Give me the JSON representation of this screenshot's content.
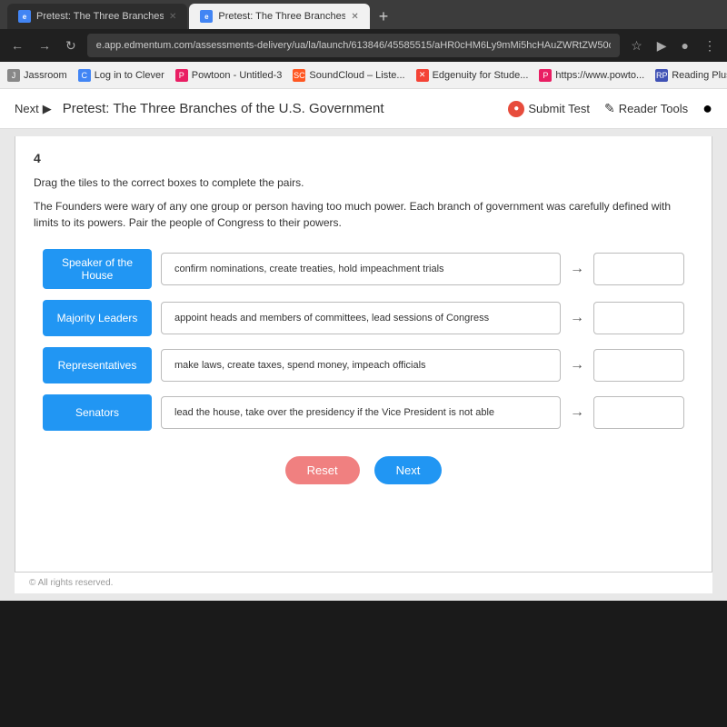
{
  "browser": {
    "tabs": [
      {
        "id": "tab-1",
        "label": "Pretest: The Three Branches of th",
        "favicon_color": "#4285f4",
        "favicon_letter": "e",
        "active": false
      },
      {
        "id": "tab-2",
        "label": "Pretest: The Three Branches of th",
        "favicon_color": "#4285f4",
        "favicon_letter": "e",
        "active": true
      }
    ],
    "tab_add_label": "+",
    "address": "e.app.edmentum.com/assessments-delivery/ua/la/launch/613846/45585515/aHR0cHM6Ly9mMi5hcHAuZWRtZW50dW0uY29tL...",
    "bookmarks": [
      {
        "label": "Jassroom",
        "color": "#4CAF50"
      },
      {
        "label": "Log in to Clever",
        "color": "#4285f4"
      },
      {
        "label": "Powtoon - Untitled-3",
        "color": "#e91e63"
      },
      {
        "label": "SoundCloud – Liste...",
        "color": "#ff5722"
      },
      {
        "label": "Edgenuity for Stude...",
        "color": "#f44336"
      },
      {
        "label": "https://www.powto...",
        "color": "#2196f3"
      },
      {
        "label": "Reading Plus | Ada...",
        "color": "#3f51b5"
      }
    ]
  },
  "app": {
    "nav_next_label": "Next",
    "title": "Pretest: The Three Branches of the U.S. Government",
    "submit_test_label": "Submit Test",
    "reader_tools_label": "Reader Tools"
  },
  "question": {
    "number": "4",
    "instruction": "Drag the tiles to the correct boxes to complete the pairs.",
    "passage": "The Founders were wary of any one group or person having too much power. Each branch of government was carefully defined with limits to its powers. Pair the people of Congress to their powers.",
    "rows": [
      {
        "label": "Speaker of the House",
        "description": "confirm nominations, create treaties, hold impeachment trials",
        "drop_value": ""
      },
      {
        "label": "Majority Leaders",
        "description": "appoint heads and members of committees, lead sessions of Congress",
        "drop_value": ""
      },
      {
        "label": "Representatives",
        "description": "make laws, create taxes, spend money, impeach officials",
        "drop_value": ""
      },
      {
        "label": "Senators",
        "description": "lead the house, take over the presidency if the Vice President is not able",
        "drop_value": ""
      }
    ],
    "buttons": {
      "reset_label": "Reset",
      "next_label": "Next"
    }
  },
  "footer": {
    "text": "© All rights reserved."
  }
}
